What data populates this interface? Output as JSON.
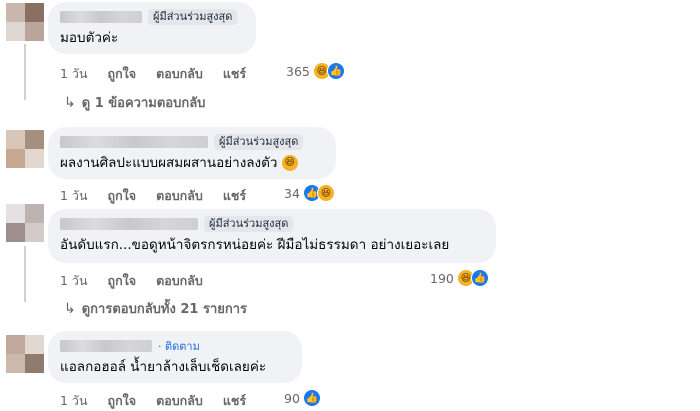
{
  "comments": [
    {
      "badge": "ผู้มีส่วนร่วมสูงสุด",
      "text": "มอบตัวค่ะ",
      "time": "1 วัน",
      "like": "ถูกใจ",
      "reply": "ตอบกลับ",
      "share": "แชร์",
      "reaction_count": "365",
      "reactions": [
        "haha-icon",
        "like-icon"
      ],
      "view_replies": "ดู 1 ข้อความตอบกลับ"
    },
    {
      "badge": "ผู้มีส่วนร่วมสูงสุด",
      "text": "ผลงานศิลปะแบบผสมผสานอย่างลงตัว",
      "time": "1 วัน",
      "like": "ถูกใจ",
      "reply": "ตอบกลับ",
      "share": "แชร์",
      "reaction_count": "34",
      "reactions": [
        "like-icon",
        "haha-icon"
      ]
    },
    {
      "badge": "ผู้มีส่วนร่วมสูงสุด",
      "text": "อันดับแรก...ขอดูหน้าจิตรกรหน่อยค่ะ ฝีมือไม่ธรรมดา อย่างเยอะเลย",
      "time": "1 วัน",
      "like": "ถูกใจ",
      "reply": "ตอบกลับ",
      "reaction_count": "190",
      "reactions": [
        "haha-icon",
        "like-icon"
      ],
      "view_replies": "ดูการตอบกลับทั้ง 21 รายการ"
    },
    {
      "follow": "· ติดตาม",
      "text": "แอลกอฮอล์ น้ำยาล้างเล็บเช็ดเลยค่ะ",
      "time": "1 วัน",
      "like": "ถูกใจ",
      "reply": "ตอบกลับ",
      "share": "แชร์",
      "reaction_count": "90",
      "reactions": [
        "like-icon"
      ]
    }
  ],
  "colors": {
    "bubble": "#f0f2f5",
    "meta": "#65676b",
    "like_blue": "#1877f2",
    "haha_yellow": "#f7b125",
    "follow_blue": "#216fdb"
  }
}
